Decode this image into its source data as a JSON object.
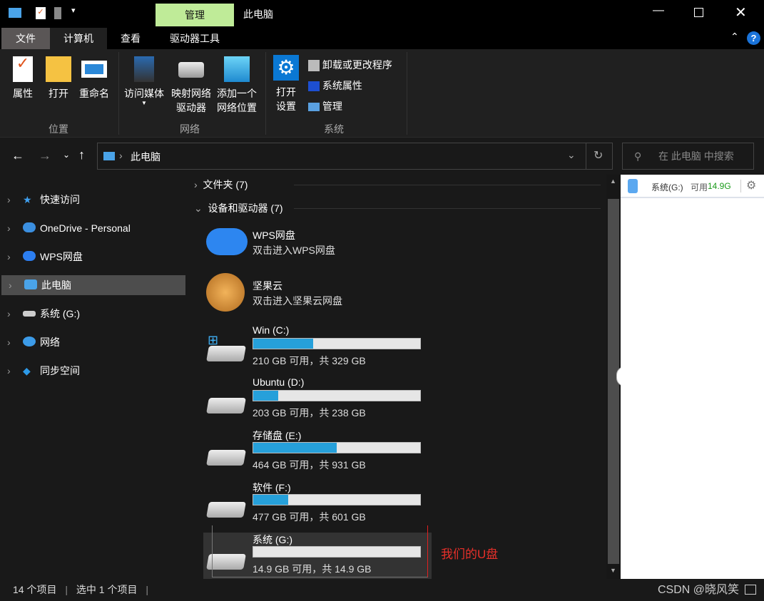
{
  "title": {
    "context_tab": "管理",
    "window_title": "此电脑"
  },
  "tabs": [
    "文件",
    "计算机",
    "查看",
    "驱动器工具"
  ],
  "ribbon": {
    "location": {
      "label": "位置",
      "buttons": [
        "属性",
        "打开",
        "重命名"
      ]
    },
    "network": {
      "label": "网络",
      "buttons": [
        "访问媒体",
        "映射网络\n驱动器",
        "添加一个\n网络位置"
      ]
    },
    "system": {
      "label": "系统",
      "open_settings": "打开\n设置",
      "items": [
        "卸载或更改程序",
        "系统属性",
        "管理"
      ]
    }
  },
  "address": {
    "path": "此电脑",
    "search_placeholder": "在 此电脑 中搜索"
  },
  "nav": [
    "快速访问",
    "OneDrive - Personal",
    "WPS网盘",
    "此电脑",
    "系统 (G:)",
    "网络",
    "同步空间"
  ],
  "sections": {
    "folders": "文件夹 (7)",
    "devices": "设备和驱动器 (7)"
  },
  "cloud": [
    {
      "name": "WPS网盘",
      "desc": "双击进入WPS网盘"
    },
    {
      "name": "坚果云",
      "desc": "双击进入坚果云网盘"
    }
  ],
  "drives": [
    {
      "name": "Win (C:)",
      "info": "210 GB 可用，共 329 GB",
      "used": 0.36
    },
    {
      "name": "Ubuntu (D:)",
      "info": "203 GB 可用，共 238 GB",
      "used": 0.15
    },
    {
      "name": "存储盘 (E:)",
      "info": "464 GB 可用，共 931 GB",
      "used": 0.5
    },
    {
      "name": "软件 (F:)",
      "info": "477 GB 可用，共 601 GB",
      "used": 0.21
    },
    {
      "name": "系统 (G:)",
      "info": "14.9 GB 可用，共 14.9 GB",
      "used": 0.0
    }
  ],
  "annotation": "我们的U盘",
  "panel": {
    "drive": "系统(G:)",
    "avail_label": "可用",
    "avail": "14.9G"
  },
  "status": {
    "count": "14 个项目",
    "selected": "选中 1 个项目"
  },
  "watermark": "CSDN @晓风笑"
}
